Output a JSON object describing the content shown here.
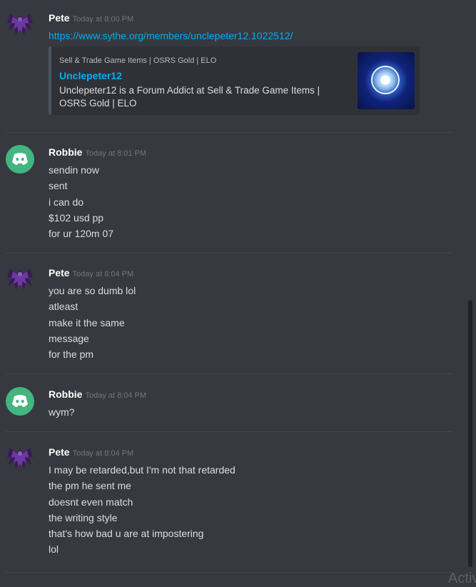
{
  "groups": [
    {
      "user": "Pete",
      "avatar": "pete-winged-avatar",
      "timestamp": "Today at 8:00 PM",
      "link": "https://www.sythe.org/members/unclepeter12.1022512/",
      "embed": {
        "provider": "Sell & Trade Game Items | OSRS Gold | ELO",
        "title": "Unclepeter12",
        "description": "Unclepeter12 is a Forum Addict at Sell & Trade Game Items | OSRS Gold | ELO",
        "thumbnail_icon": "forum-badge-icon"
      },
      "lines": []
    },
    {
      "user": "Robbie",
      "avatar": "discord-default-avatar",
      "timestamp": "Today at 8:01 PM",
      "lines": [
        "sendin now",
        "sent",
        "i can do",
        "$102 usd pp",
        "for ur 120m 07"
      ]
    },
    {
      "user": "Pete",
      "avatar": "pete-winged-avatar",
      "timestamp": "Today at 8:04 PM",
      "lines": [
        "you are so dumb lol",
        "atleast",
        "make it the same",
        "message",
        "for the pm"
      ]
    },
    {
      "user": "Robbie",
      "avatar": "discord-default-avatar",
      "timestamp": "Today at 8:04 PM",
      "lines": [
        "wym?"
      ]
    },
    {
      "user": "Pete",
      "avatar": "pete-winged-avatar",
      "timestamp": "Today at 8:04 PM",
      "lines": [
        "I may be retarded,but I'm not that retarded",
        "the pm he sent me",
        "doesnt even match",
        "the writing style",
        "that's how bad u are at impostering",
        "lol"
      ]
    }
  ],
  "watermark": "Activ",
  "colors": {
    "background": "#36393f",
    "link": "#00b0f4",
    "robbie_avatar": "#43b581"
  }
}
